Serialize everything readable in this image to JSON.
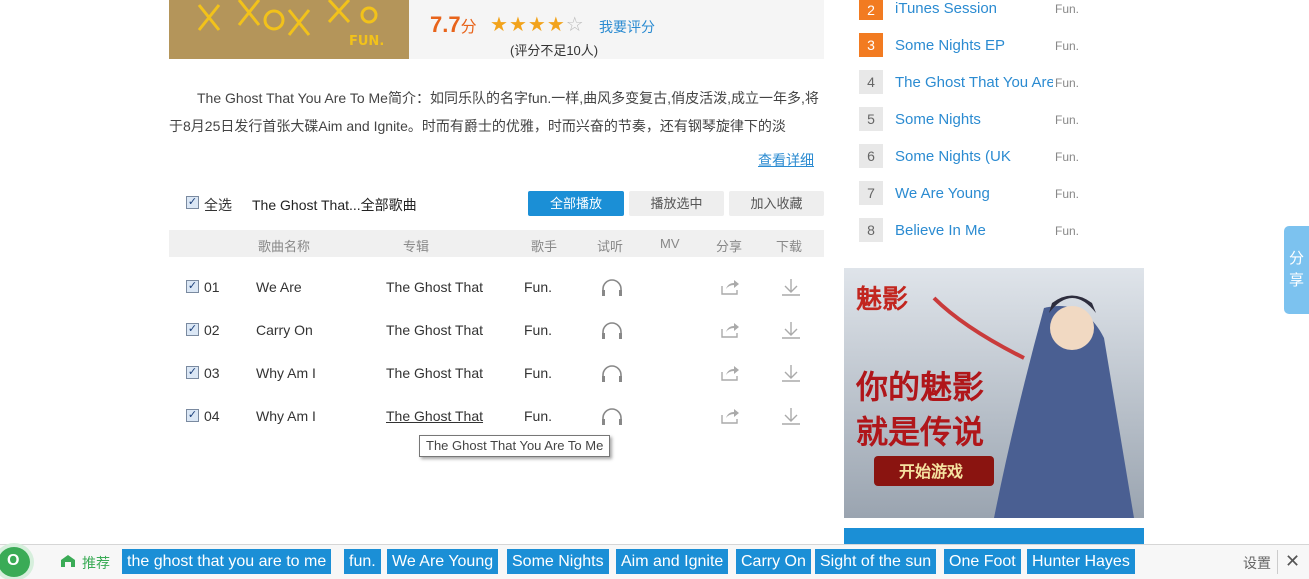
{
  "album": {
    "score": "7.7",
    "score_unit": "分",
    "rating_stars": 4,
    "rating_max": 5,
    "rate_link": "我要评分",
    "rate_count": "(评分不足10人)",
    "intro": "The Ghost That You Are To Me简介：如同乐队的名字fun.一样,曲风多变复古,俏皮活泼,成立一年多,将于8月25日发行首张大碟Aim and Ignite。时而有爵士的优雅，时而兴奋的节奏，还有钢琴旋律下的淡",
    "more_link": "查看详细"
  },
  "toolbar": {
    "select_all": "全选",
    "album_songs": "The Ghost That...全部歌曲",
    "play_all": "全部播放",
    "play_selected": "播放选中",
    "add_favorite": "加入收藏"
  },
  "table": {
    "headers": [
      "歌曲名称",
      "专辑",
      "歌手",
      "试听",
      "MV",
      "分享",
      "下载"
    ],
    "rows": [
      {
        "num": "01",
        "title": "We Are",
        "album": "The Ghost That",
        "artist": "Fun."
      },
      {
        "num": "02",
        "title": "Carry On",
        "album": "The Ghost That",
        "artist": "Fun."
      },
      {
        "num": "03",
        "title": "Why Am I",
        "album": "The Ghost That",
        "artist": "Fun."
      },
      {
        "num": "04",
        "title": "Why Am I",
        "album": "The Ghost That",
        "artist": "Fun."
      }
    ],
    "tooltip": "The Ghost That You Are To Me"
  },
  "sidebar": {
    "ranking": [
      {
        "rank": "2",
        "title": "iTunes Session",
        "artist": "Fun."
      },
      {
        "rank": "3",
        "title": "Some Nights EP",
        "artist": "Fun."
      },
      {
        "rank": "4",
        "title": "The Ghost That You Are",
        "artist": "Fun."
      },
      {
        "rank": "5",
        "title": "Some Nights",
        "artist": "Fun."
      },
      {
        "rank": "6",
        "title": "Some Nights (UK",
        "artist": "Fun."
      },
      {
        "rank": "7",
        "title": "We Are Young",
        "artist": "Fun."
      },
      {
        "rank": "8",
        "title": "Believe In Me",
        "artist": "Fun."
      }
    ]
  },
  "share_tab": [
    "分",
    "享"
  ],
  "bottom": {
    "rec_label": "推荐",
    "tags": [
      "the ghost that you are to me",
      "fun.",
      "We Are Young",
      "Some Nights",
      "Aim and Ignite",
      "Carry On",
      "Sight of the sun",
      "One Foot",
      "Hunter Hayes"
    ],
    "settings": "设置"
  },
  "colors": {
    "accent": "#1b8fd6",
    "link": "#2b8bd1",
    "rank_hot": "#f27b21",
    "score": "#e8641b",
    "green": "#3aab56"
  }
}
